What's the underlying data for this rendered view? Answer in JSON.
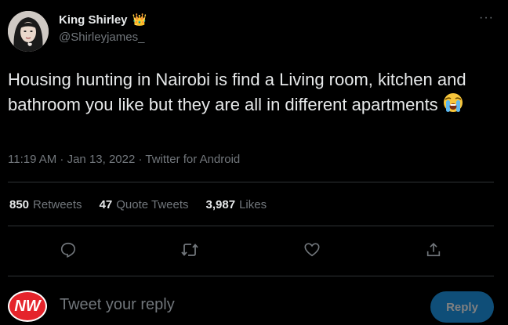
{
  "user": {
    "display_name": "King Shirley",
    "badge_emoji": "👑",
    "handle": "@Shirleyjames_"
  },
  "tweet": {
    "text": "Housing hunting in Nairobi is find a Living room, kitchen and bathroom you like but they are all in different apartments",
    "emoji": "crying-face",
    "meta": "11:19 AM · Jan 13, 2022 · Twitter for Android"
  },
  "stats": {
    "retweets_count": "850",
    "retweets_label": "Retweets",
    "quotes_count": "47",
    "quotes_label": "Quote Tweets",
    "likes_count": "3,987",
    "likes_label": "Likes"
  },
  "actions": {
    "icons": [
      "reply-icon",
      "retweet-icon",
      "like-icon",
      "share-icon"
    ]
  },
  "reply": {
    "avatar_text": "NW",
    "placeholder": "Tweet your reply",
    "button_label": "Reply"
  },
  "colors": {
    "background": "#000000",
    "text_primary": "#e7e9ea",
    "text_secondary": "#71767b",
    "divider": "#2f3336",
    "reply_button": "#0f4e78",
    "reply_avatar": "#e5242b"
  }
}
